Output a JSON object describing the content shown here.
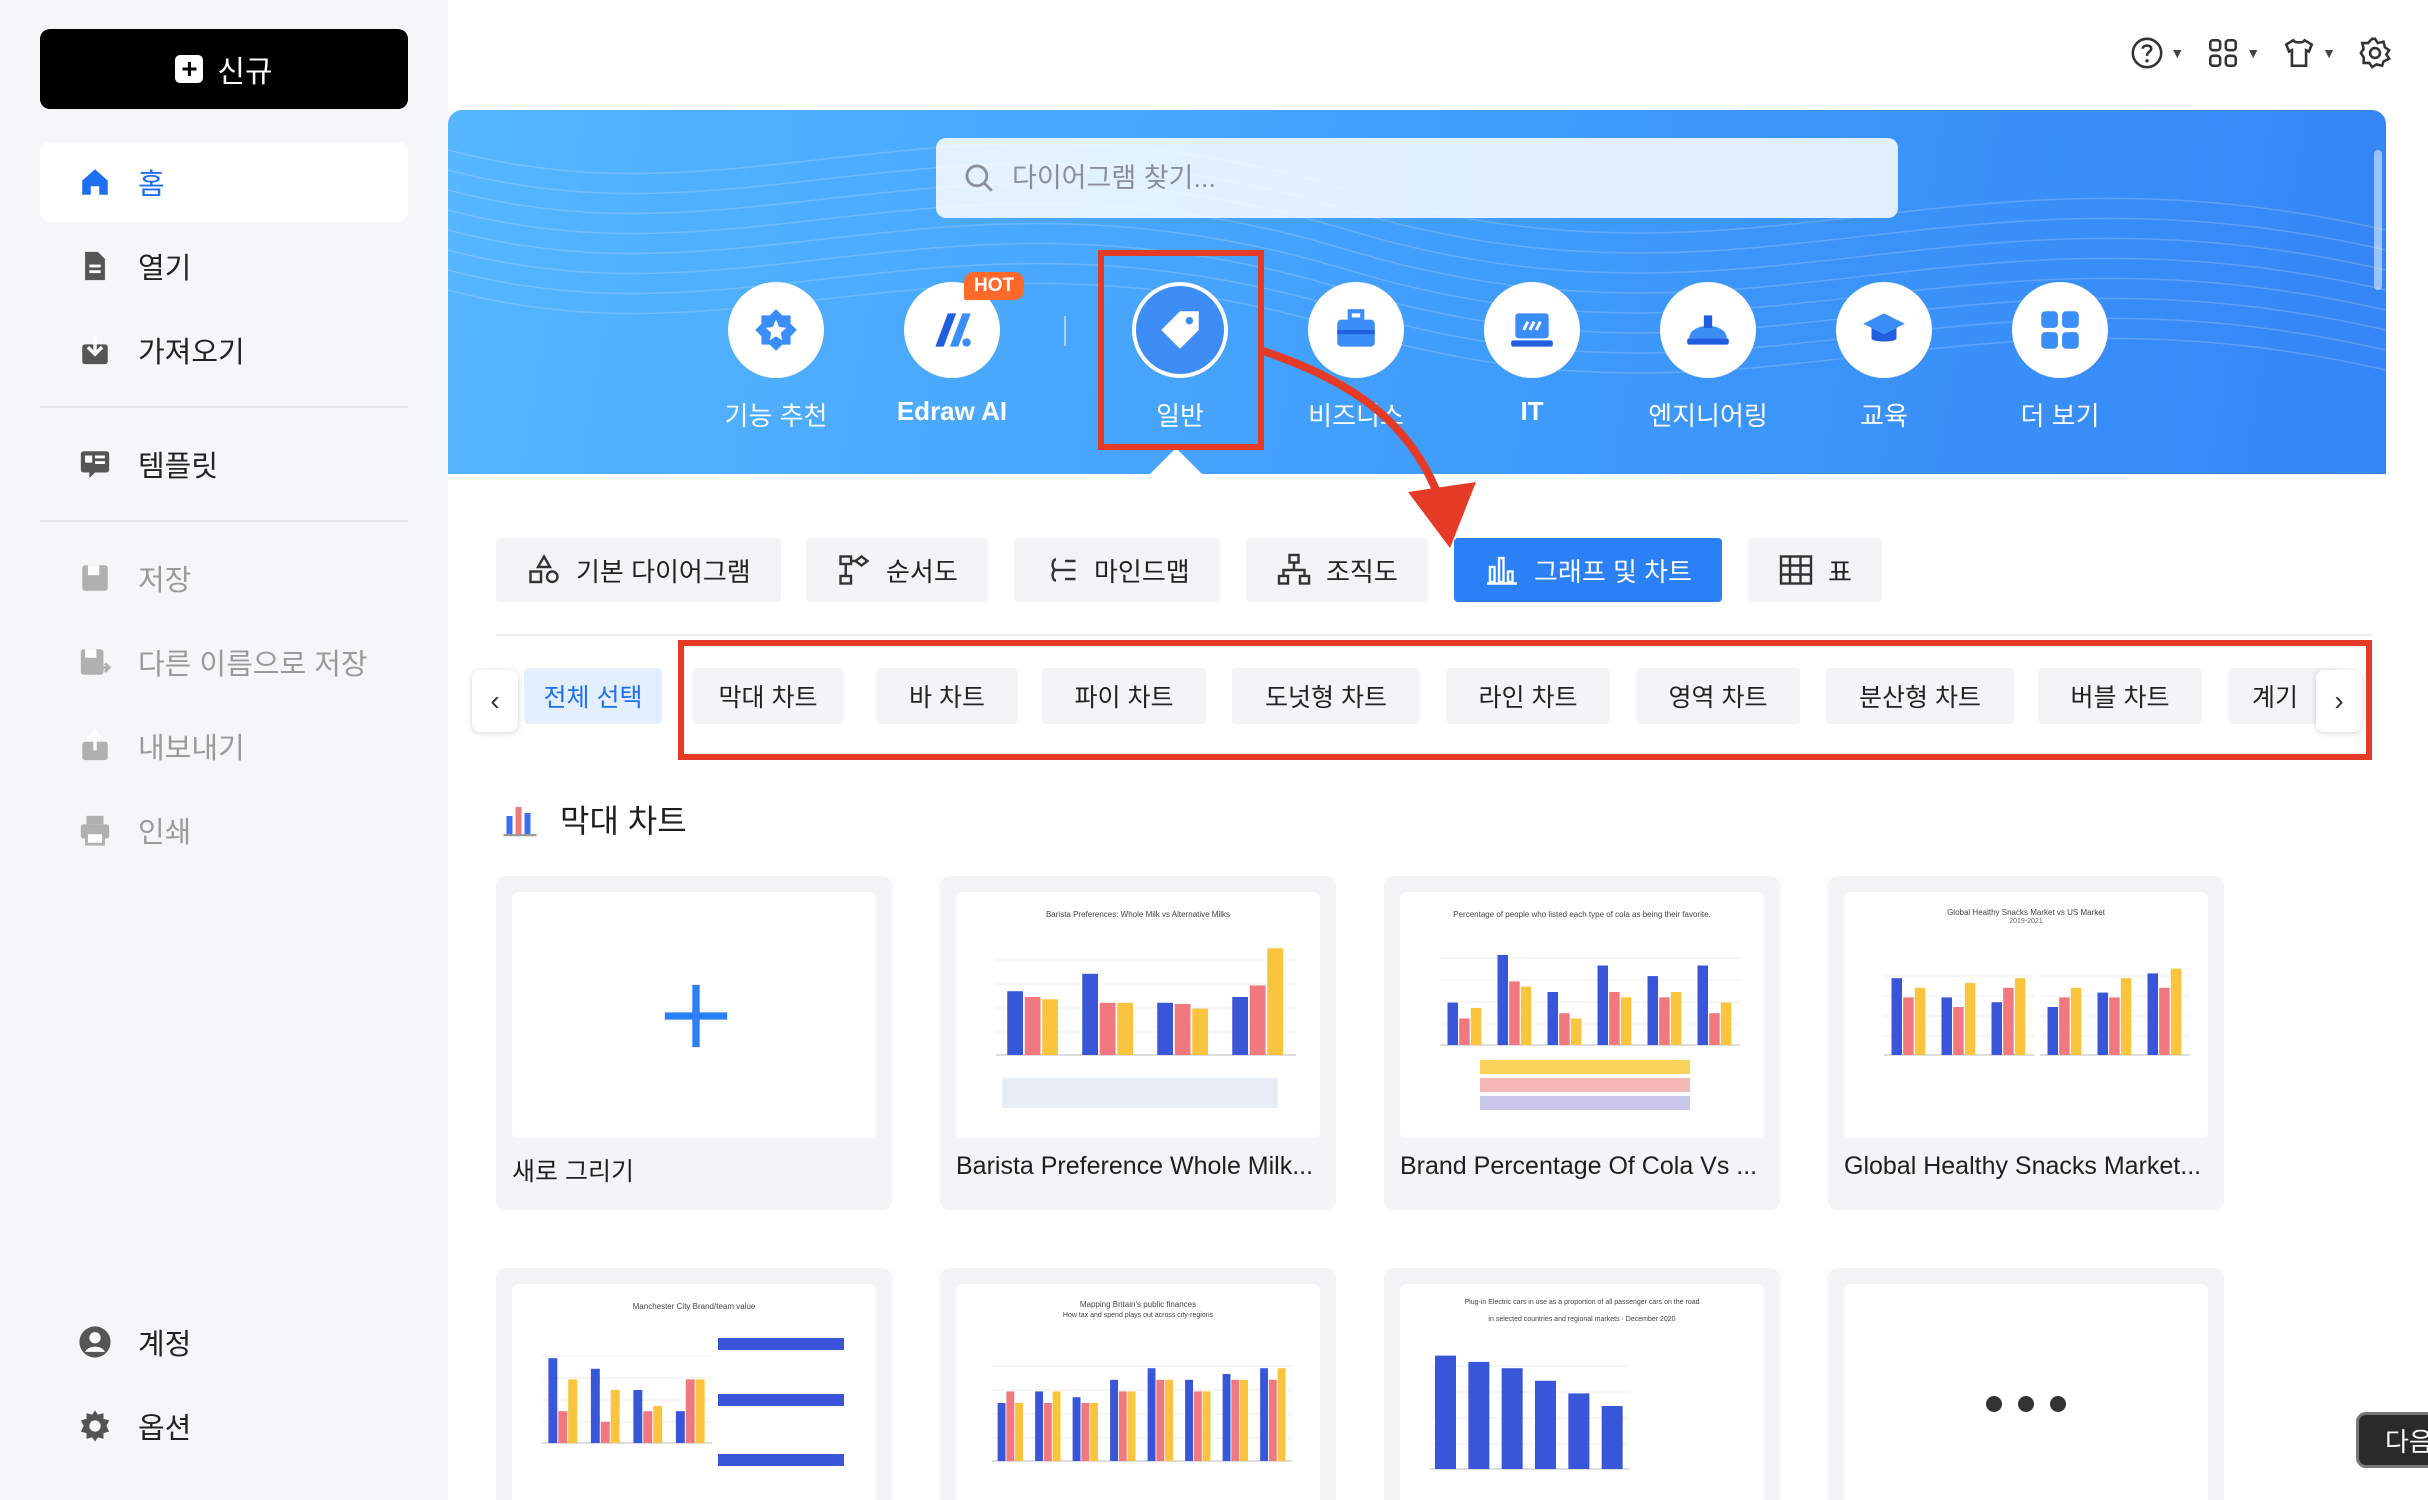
{
  "sidebar": {
    "new_label": "신규",
    "home": "홈",
    "open": "열기",
    "import": "가져오기",
    "templates": "템플릿",
    "save": "저장",
    "save_as": "다른 이름으로 저장",
    "export": "내보내기",
    "print": "인쇄",
    "account": "계정",
    "options": "옵션"
  },
  "search": {
    "placeholder": "다이어그램 찾기..."
  },
  "categories": [
    {
      "label": "기능 추천",
      "icon": "star-badge-icon"
    },
    {
      "label": "Edraw AI",
      "icon": "edraw-ai-icon",
      "badge": "HOT"
    },
    {
      "label": "일반",
      "icon": "tag-icon"
    },
    {
      "label": "비즈니스",
      "icon": "briefcase-icon"
    },
    {
      "label": "IT",
      "icon": "laptop-icon"
    },
    {
      "label": "엔지니어링",
      "icon": "helmet-icon"
    },
    {
      "label": "교육",
      "icon": "graduation-cap-icon"
    },
    {
      "label": "더 보기",
      "icon": "grid-icon"
    }
  ],
  "tabs": [
    "기본 다이어그램",
    "순서도",
    "마인드맵",
    "조직도",
    "그래프 및 차트",
    "표"
  ],
  "chips": [
    "전체 선택",
    "막대 차트",
    "바 차트",
    "파이 차트",
    "도넛형 차트",
    "라인 차트",
    "영역 차트",
    "분산형 차트",
    "버블 차트",
    "계기"
  ],
  "section": {
    "title": "막대 차트"
  },
  "cards": [
    {
      "title": "새로 그리기"
    },
    {
      "title": "Barista Preference Whole Milk...",
      "thumb_heading": "Barista Preferences: Whole Milk vs Alternative Milks"
    },
    {
      "title": "Brand Percentage Of Cola Vs ...",
      "thumb_heading": "Percentage of people who listed each type of cola as being their favorite."
    },
    {
      "title": "Global Healthy Snacks Market...",
      "thumb_heading": "Global Healthy Snacks Market vs US Market",
      "thumb_sub": "2019-2021"
    }
  ],
  "cards_row2": [
    {
      "thumb_heading": "Manchester City Brand/team value"
    },
    {
      "thumb_heading": "Mapping Britain's public finances",
      "thumb_sub": "How tax and spend plays out across city-regions"
    },
    {
      "thumb_heading": "Plug-in Electric cars in use as a proportion of all passenger cars on the road",
      "thumb_sub": "in selected countries and regional markets · December 2020"
    },
    {
      "more": true
    }
  ],
  "next_label": "다음",
  "colors": {
    "accent": "#2b80f6",
    "annotation_red": "#e53a25",
    "bar_blue": "#3a56d8",
    "bar_pink": "#f0787e",
    "bar_yellow": "#fbc43f"
  }
}
